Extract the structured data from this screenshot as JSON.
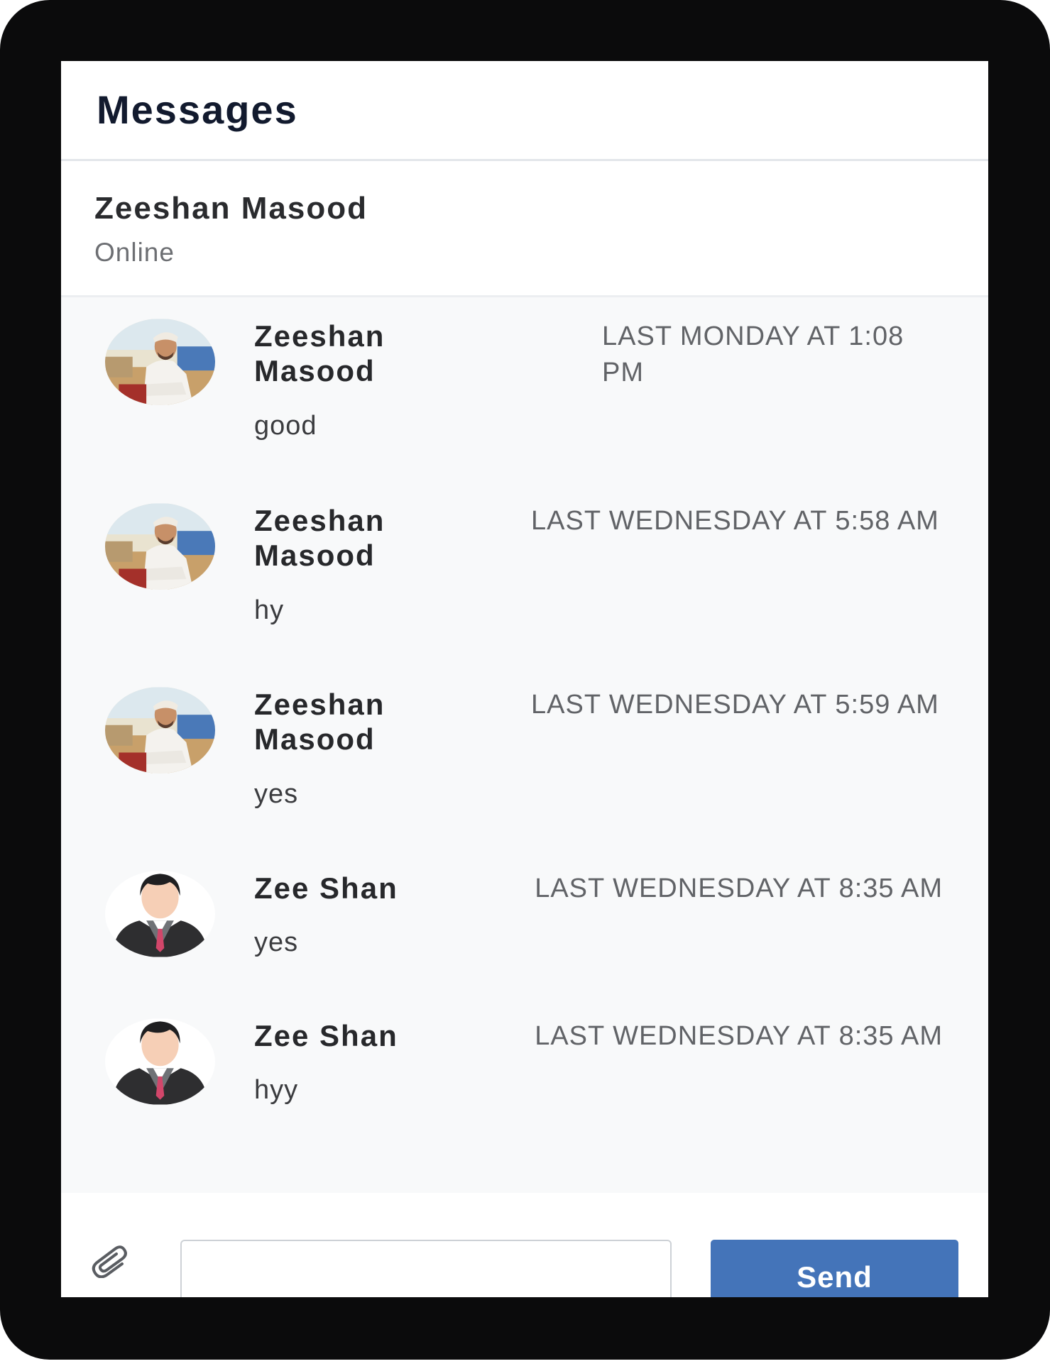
{
  "header": {
    "title": "Messages"
  },
  "contact": {
    "name": "Zeeshan Masood",
    "status": "Online"
  },
  "messages": [
    {
      "sender": "Zeeshan Masood",
      "time": "LAST MONDAY AT 1:08 PM",
      "text": "good",
      "avatar": "photo-avatar"
    },
    {
      "sender": "Zeeshan Masood",
      "time": "LAST WEDNESDAY AT 5:58 AM",
      "text": "hy",
      "avatar": "photo-avatar"
    },
    {
      "sender": "Zeeshan Masood",
      "time": "LAST WEDNESDAY AT 5:59 AM",
      "text": "yes",
      "avatar": "photo-avatar"
    },
    {
      "sender": "Zee Shan",
      "time": "LAST WEDNESDAY AT 8:35 AM",
      "text": "yes",
      "avatar": "default-user-avatar"
    },
    {
      "sender": "Zee Shan",
      "time": "LAST WEDNESDAY AT 8:35 AM",
      "text": "hyy",
      "avatar": "default-user-avatar"
    }
  ],
  "composer": {
    "attach_icon": "paperclip-icon",
    "input_value": "",
    "send_label": "Send"
  },
  "colors": {
    "frame": "#0b0b0c",
    "send_button": "#4474b9",
    "thread_background": "#f8f9fa"
  }
}
